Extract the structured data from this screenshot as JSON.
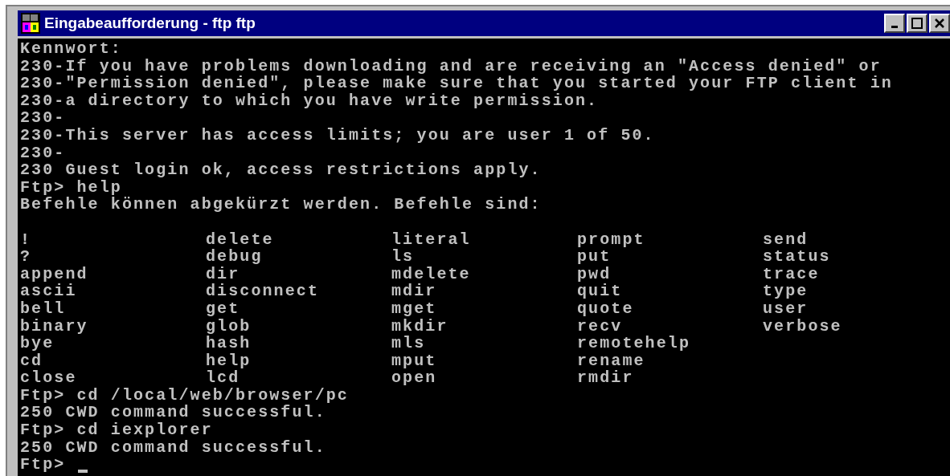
{
  "window": {
    "title": "Eingabeaufforderung - ftp ftp"
  },
  "console": {
    "lines_before": [
      "Kennwort:",
      "230-If you have problems downloading and are receiving an \"Access denied\" or",
      "230-\"Permission denied\", please make sure that you started your FTP client in",
      "230-a directory to which you have write permission.",
      "230-",
      "230-This server has access limits; you are user 1 of 50.",
      "230-",
      "230 Guest login ok, access restrictions apply.",
      "Ftp> help",
      "Befehle können abgekürzt werden. Befehle sind:"
    ],
    "command_table": [
      [
        "!",
        "delete",
        "literal",
        "prompt",
        "send"
      ],
      [
        "?",
        "debug",
        "ls",
        "put",
        "status"
      ],
      [
        "append",
        "dir",
        "mdelete",
        "pwd",
        "trace"
      ],
      [
        "ascii",
        "disconnect",
        "mdir",
        "quit",
        "type"
      ],
      [
        "bell",
        "get",
        "mget",
        "quote",
        "user"
      ],
      [
        "binary",
        "glob",
        "mkdir",
        "recv",
        "verbose"
      ],
      [
        "bye",
        "hash",
        "mls",
        "remotehelp"
      ],
      [
        "cd",
        "help",
        "mput",
        "rename"
      ],
      [
        "close",
        "lcd",
        "open",
        "rmdir"
      ]
    ],
    "lines_after": [
      "Ftp> cd /local/web/browser/pc",
      "250 CWD command successful.",
      "Ftp> cd iexplorer",
      "250 CWD command successful."
    ],
    "prompt": "Ftp>"
  }
}
